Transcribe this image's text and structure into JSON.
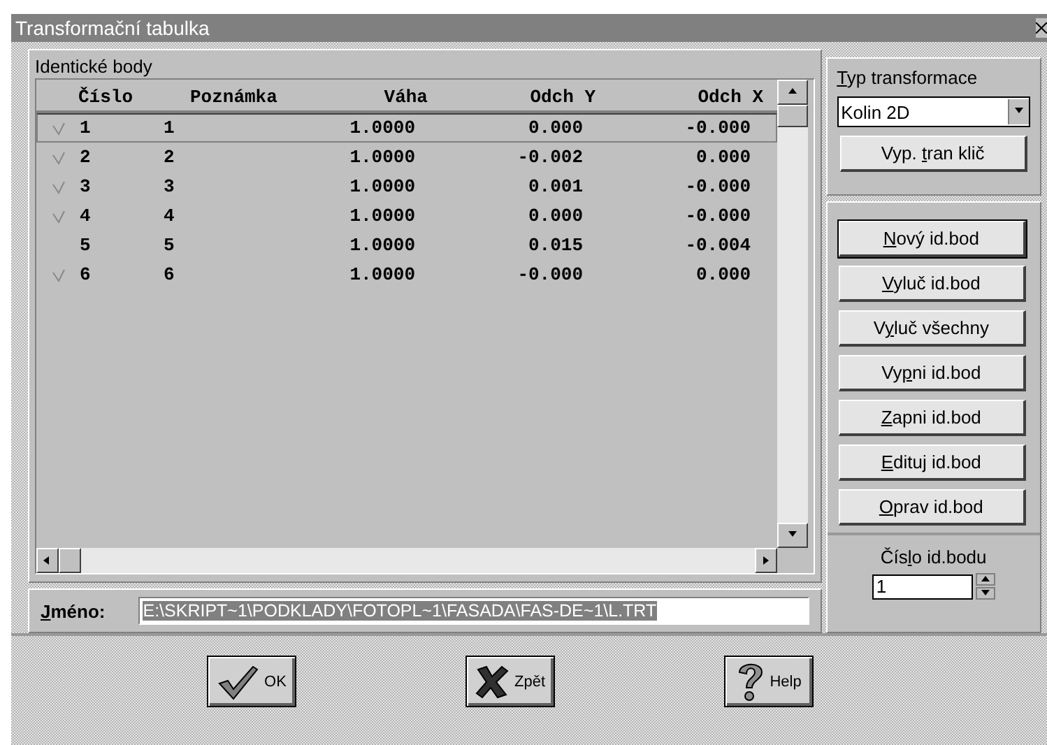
{
  "window": {
    "title": "Transformační tabulka"
  },
  "identical_points": {
    "title": "Identické body",
    "columns": [
      "Číslo",
      "Poznámka",
      "Váha",
      "Odch Y",
      "Odch X"
    ],
    "rows": [
      {
        "checked": true,
        "selected": true,
        "cells": [
          "1",
          "1",
          "1.0000",
          "0.000",
          "-0.000"
        ]
      },
      {
        "checked": true,
        "selected": false,
        "cells": [
          "2",
          "2",
          "1.0000",
          "-0.002",
          "0.000"
        ]
      },
      {
        "checked": true,
        "selected": false,
        "cells": [
          "3",
          "3",
          "1.0000",
          "0.001",
          "-0.000"
        ]
      },
      {
        "checked": true,
        "selected": false,
        "cells": [
          "4",
          "4",
          "1.0000",
          "0.000",
          "-0.000"
        ]
      },
      {
        "checked": false,
        "selected": false,
        "cells": [
          "5",
          "5",
          "1.0000",
          "0.015",
          "-0.004"
        ]
      },
      {
        "checked": true,
        "selected": false,
        "cells": [
          "6",
          "6",
          "1.0000",
          "-0.000",
          "0.000"
        ]
      }
    ]
  },
  "name_field": {
    "label": {
      "key": "J",
      "post": "méno:"
    },
    "value": "E:\\SKRIPT~1\\PODKLADY\\FOTOPL~1\\FASADA\\FAS-DE~1\\L.TRT",
    "text_selected": true
  },
  "transform_type": {
    "label": {
      "key": "T",
      "post": "yp transformace"
    },
    "value": "Kolin  2D",
    "button": {
      "pre": "Vyp. ",
      "key": "t",
      "post": "ran klič"
    }
  },
  "actions": [
    {
      "key": "N",
      "post": "ový id.bod",
      "default": true
    },
    {
      "key": "V",
      "post": "yluč id.bod",
      "default": false
    },
    {
      "pre": "V",
      "key": "y",
      "post": "luč všechny",
      "default": false
    },
    {
      "pre": "Vy",
      "key": "p",
      "post": "ni id.bod",
      "default": false
    },
    {
      "key": "Z",
      "post": "apni id.bod",
      "default": false
    },
    {
      "key": "E",
      "post": "dituj id.bod",
      "default": false
    },
    {
      "key": "O",
      "post": "prav id.bod",
      "default": false
    }
  ],
  "point_number": {
    "label": {
      "pre": "Čís",
      "key": "l",
      "post": "o id.bodu"
    },
    "value": "1"
  },
  "footer_buttons": [
    {
      "kind": "ok",
      "label": "OK"
    },
    {
      "kind": "cancel",
      "label": "Zpět"
    },
    {
      "kind": "help",
      "label": "Help"
    }
  ]
}
